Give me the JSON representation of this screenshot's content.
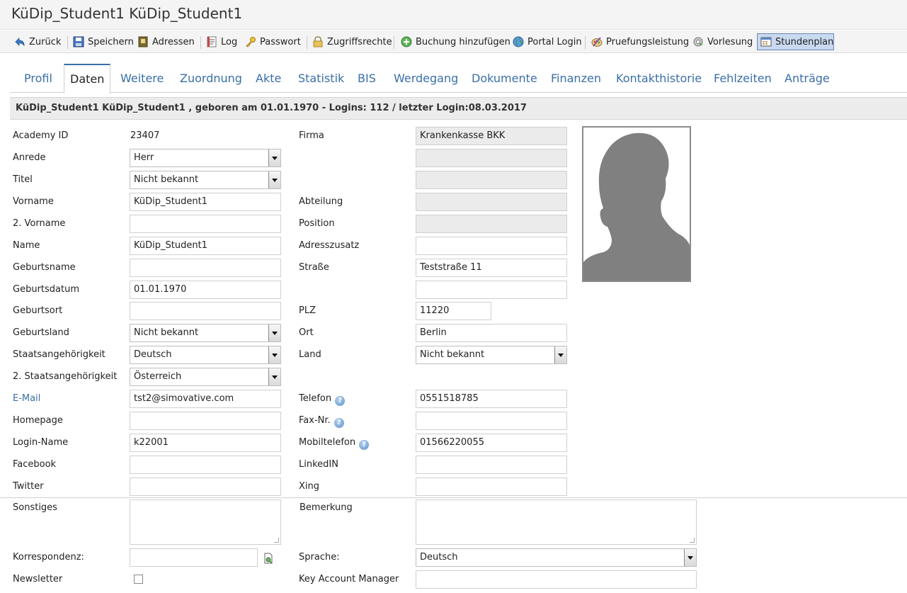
{
  "window": {
    "title": "KüDip_Student1 KüDip_Student1"
  },
  "toolbar": {
    "back": "Zurück",
    "save": "Speichern",
    "addresses": "Adressen",
    "log": "Log",
    "password": "Passwort",
    "access_rights": "Zugriffsrechte",
    "add_booking": "Buchung hinzufügen",
    "portal_login": "Portal Login",
    "exam_performance": "Pruefungsleistung",
    "lecture": "Vorlesung",
    "timetable": "Stundenplan"
  },
  "tabs": [
    "Profil",
    "Daten",
    "Weitere",
    "Zuordnung",
    "Akte",
    "Statistik",
    "BIS",
    "Werdegang",
    "Dokumente",
    "Finanzen",
    "Kontakthistorie",
    "Fehlzeiten",
    "Anträge"
  ],
  "active_tab": "Daten",
  "info": "KüDip_Student1 KüDip_Student1 , geboren am 01.01.1970 - Logins: 112 / letzter Login:08.03.2017",
  "left": {
    "academy_id_label": "Academy ID",
    "academy_id_value": "23407",
    "anrede_label": "Anrede",
    "anrede_value": "Herr",
    "titel_label": "Titel",
    "titel_value": "Nicht bekannt",
    "vorname_label": "Vorname",
    "vorname_value": "KüDip_Student1",
    "vorname2_label": "2. Vorname",
    "vorname2_value": "",
    "name_label": "Name",
    "name_value": "KüDip_Student1",
    "geburtsname_label": "Geburtsname",
    "geburtsname_value": "",
    "geburtsdatum_label": "Geburtsdatum",
    "geburtsdatum_value": "01.01.1970",
    "geburtsort_label": "Geburtsort",
    "geburtsort_value": "",
    "geburtsland_label": "Geburtsland",
    "geburtsland_value": "Nicht bekannt",
    "staat_label": "Staatsangehörigkeit",
    "staat_value": "Deutsch",
    "staat2_label": "2. Staatsangehörigkeit",
    "staat2_value": "Österreich",
    "email_label": "E-Mail",
    "email_value": "tst2@simovative.com",
    "homepage_label": "Homepage",
    "homepage_value": "",
    "login_label": "Login-Name",
    "login_value": "k22001",
    "facebook_label": "Facebook",
    "facebook_value": "",
    "twitter_label": "Twitter",
    "twitter_value": ""
  },
  "right": {
    "firma_label": "Firma",
    "firma_value": "Krankenkasse BKK",
    "abteilung_label": "Abteilung",
    "position_label": "Position",
    "adresszusatz_label": "Adresszusatz",
    "adresszusatz_value": "",
    "strasse_label": "Straße",
    "strasse_value": "Teststraße 11",
    "plz_label": "PLZ",
    "plz_value": "11220",
    "ort_label": "Ort",
    "ort_value": "Berlin",
    "land_label": "Land",
    "land_value": "Nicht bekannt",
    "telefon_label": "Telefon",
    "telefon_value": "0551518785",
    "fax_label": "Fax-Nr.",
    "fax_value": "",
    "mobil_label": "Mobiltelefon",
    "mobil_value": "01566220055",
    "linkedin_label": "LinkedIN",
    "linkedin_value": "",
    "xing_label": "Xing",
    "xing_value": ""
  },
  "bottom": {
    "sonstiges_label": "Sonstiges",
    "bemerkung_label": "Bemerkung",
    "korrespondenz_label": "Korrespondenz:",
    "korrespondenz_value": "",
    "sprache_label": "Sprache:",
    "sprache_value": "Deutsch",
    "newsletter_label": "Newsletter",
    "newsletter_checked": false,
    "kam_label": "Key Account Manager",
    "kam_value": ""
  },
  "help_glyph": "?",
  "icons": [
    "back-arrow-icon",
    "floppy-disk-icon",
    "address-book-icon",
    "log-document-icon",
    "key-icon",
    "padlock-icon",
    "plus-circle-icon",
    "globe-icon",
    "pencil-palette-icon",
    "gear-arrow-icon",
    "calendar-table-icon",
    "help-icon",
    "file-attach-icon",
    "person-silhouette-icon"
  ],
  "colors": {
    "link": "#3a6fa8",
    "active_button": "#c9d9f0",
    "info_bar": "#ececec"
  }
}
